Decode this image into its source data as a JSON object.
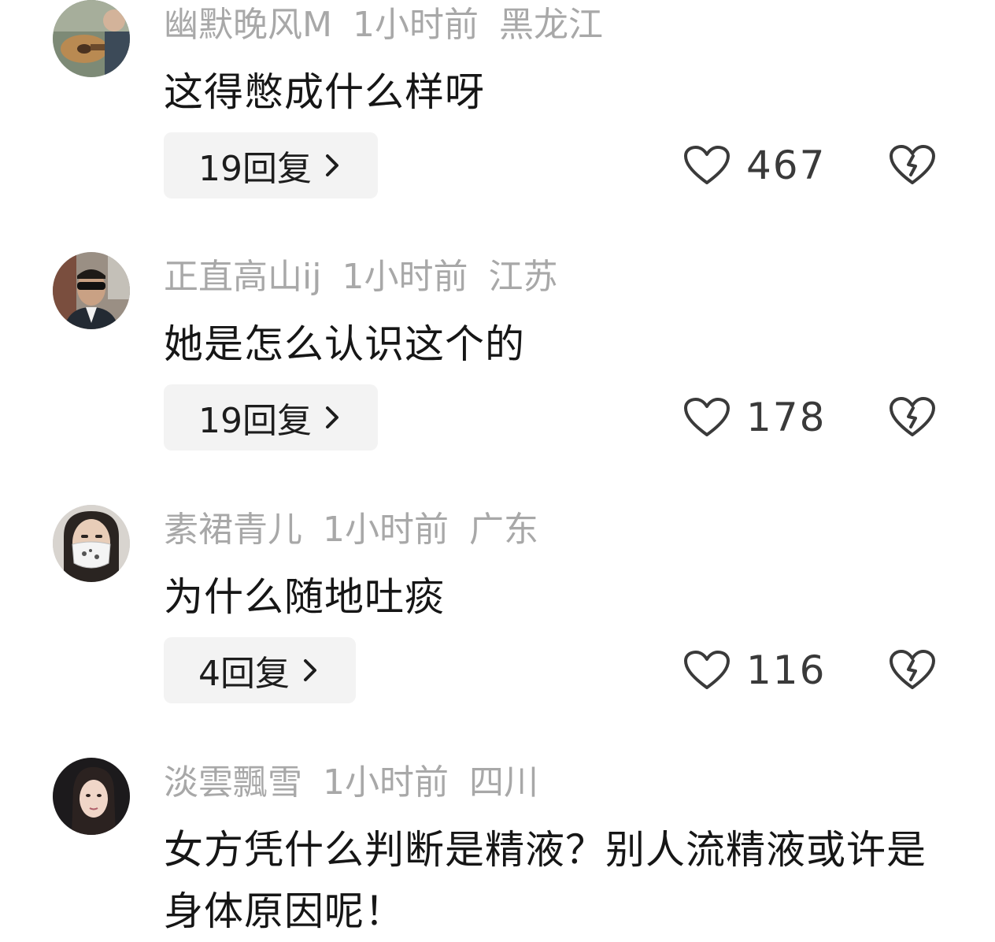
{
  "comments": [
    {
      "username": "幽默晚风M",
      "time": "1小时前",
      "location": "黑龙江",
      "text": "这得憋成什么样呀",
      "reply_label": "19回复",
      "likes": "467"
    },
    {
      "username": "正直高山ij",
      "time": "1小时前",
      "location": "江苏",
      "text": "她是怎么认识这个的",
      "reply_label": "19回复",
      "likes": "178"
    },
    {
      "username": "素裙青儿",
      "time": "1小时前",
      "location": "广东",
      "text": "为什么随地吐痰",
      "reply_label": "4回复",
      "likes": "116"
    },
    {
      "username": "淡雲飄雪",
      "time": "1小时前",
      "location": "四川",
      "text": "女方凭什么判断是精液？别人流精液或许是身体原因呢！"
    }
  ]
}
